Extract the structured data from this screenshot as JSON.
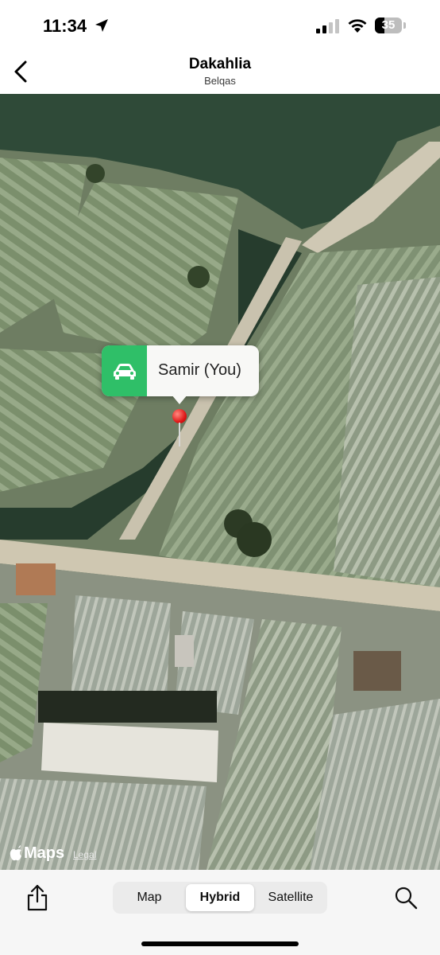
{
  "status_bar": {
    "time": "11:34",
    "battery": "35"
  },
  "nav": {
    "title": "Dakahlia",
    "subtitle": "Belqas"
  },
  "map": {
    "callout_label": "Samir (You)",
    "callout_icon": "car-icon",
    "pin_color": "#e01818",
    "attribution": "Maps",
    "legal": "Legal"
  },
  "bottom": {
    "segments": [
      "Map",
      "Hybrid",
      "Satellite"
    ],
    "selected": "Hybrid"
  },
  "colors": {
    "accent_green": "#2fbf68"
  }
}
